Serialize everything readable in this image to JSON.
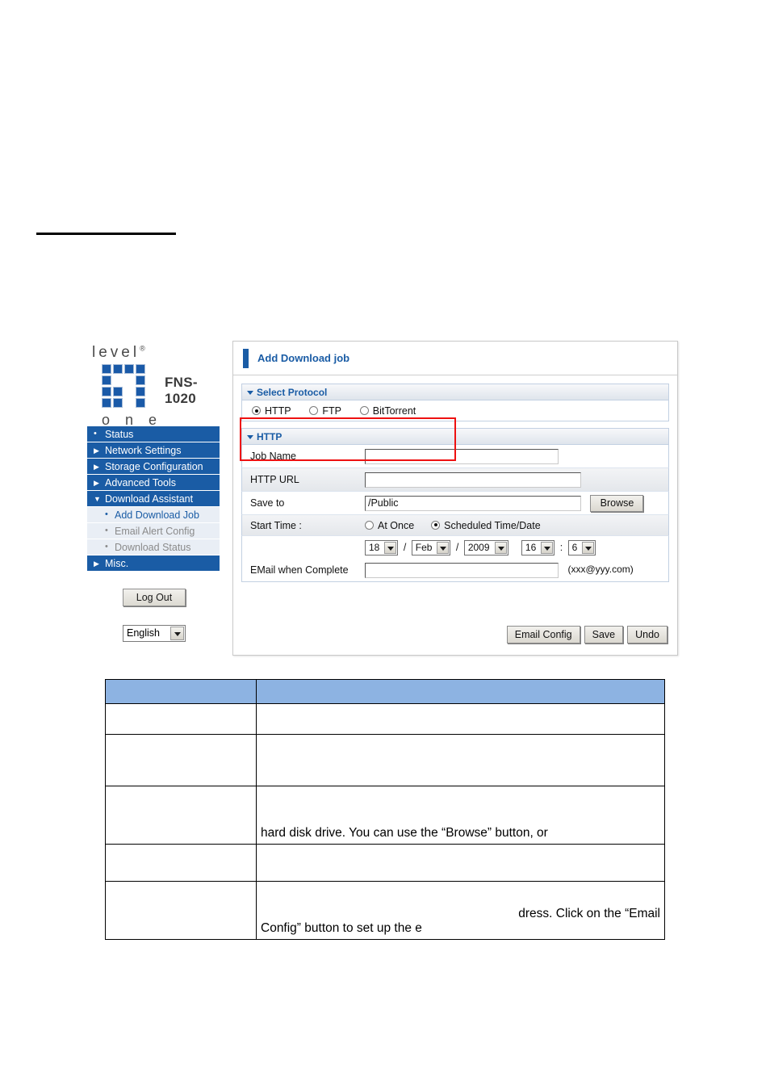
{
  "page": {
    "rule_present": true
  },
  "device_ui": {
    "brand": {
      "word_top": "level",
      "registered_mark": "®",
      "word_bottom": "o n e",
      "model": "FNS-1020",
      "logo_color": "#1a5aa8"
    },
    "nav": {
      "items": [
        {
          "label": "Status",
          "marker": "dot",
          "state": "collapsed"
        },
        {
          "label": "Network Settings",
          "marker": "right-arrow",
          "state": "collapsed"
        },
        {
          "label": "Storage Configuration",
          "marker": "right-arrow",
          "state": "collapsed"
        },
        {
          "label": "Advanced Tools",
          "marker": "right-arrow",
          "state": "collapsed"
        },
        {
          "label": "Download Assistant",
          "marker": "down-arrow",
          "state": "expanded"
        }
      ],
      "sub_items": [
        {
          "label": "Add Download Job",
          "state": "active"
        },
        {
          "label": "Email Alert Config",
          "state": "inactive"
        },
        {
          "label": "Download Status",
          "state": "inactive"
        }
      ],
      "last_item": {
        "label": "Misc.",
        "marker": "right-arrow",
        "state": "collapsed"
      },
      "active_color": "#1a5ca5",
      "bar_color": "#1a5ca5"
    },
    "logout_button": "Log Out",
    "language_select": {
      "value": "English"
    },
    "panel": {
      "title": "Add Download job",
      "select_protocol": {
        "header": "Select Protocol",
        "options": [
          {
            "label": "HTTP",
            "selected": true
          },
          {
            "label": "FTP",
            "selected": false
          },
          {
            "label": "BitTorrent",
            "selected": false
          }
        ],
        "highlight_color": "#ee1111"
      },
      "http_section": {
        "header": "HTTP",
        "job_name": {
          "label": "Job Name",
          "value": ""
        },
        "http_url": {
          "label": "HTTP URL",
          "value": ""
        },
        "save_to": {
          "label": "Save to",
          "value": "/Public",
          "browse_label": "Browse"
        },
        "start_time": {
          "label": "Start Time :",
          "options": [
            {
              "label": "At Once",
              "selected": false
            },
            {
              "label": "Scheduled Time/Date",
              "selected": true
            }
          ],
          "day": "18",
          "month": "Feb",
          "year": "2009",
          "hour": "16",
          "minute": "6",
          "date_sep": "/",
          "time_sep": ":"
        },
        "email_when_complete": {
          "label": "EMail when Complete",
          "value": "",
          "hint": "(xxx@yyy.com)"
        }
      },
      "buttons": [
        {
          "label": "Email Config"
        },
        {
          "label": "Save"
        },
        {
          "label": "Undo"
        }
      ]
    }
  },
  "doc_table": {
    "header_color": "#8db3e2",
    "header": {
      "col1": "",
      "col2": ""
    },
    "rows": [
      {
        "col1": "",
        "col2_lead": "",
        "col2_tail": ""
      },
      {
        "col1": "",
        "col2_lead": "",
        "col2_tail": ""
      },
      {
        "col1": "",
        "col2_lead": "",
        "col2_tail": "hard disk drive. You can use the “Browse” button, or"
      },
      {
        "col1": "",
        "col2_lead": "",
        "col2_tail": ""
      },
      {
        "col1": "",
        "col2_lead": "Config” button to set up the e",
        "col2_tail": "dress. Click on the “Email"
      }
    ]
  }
}
